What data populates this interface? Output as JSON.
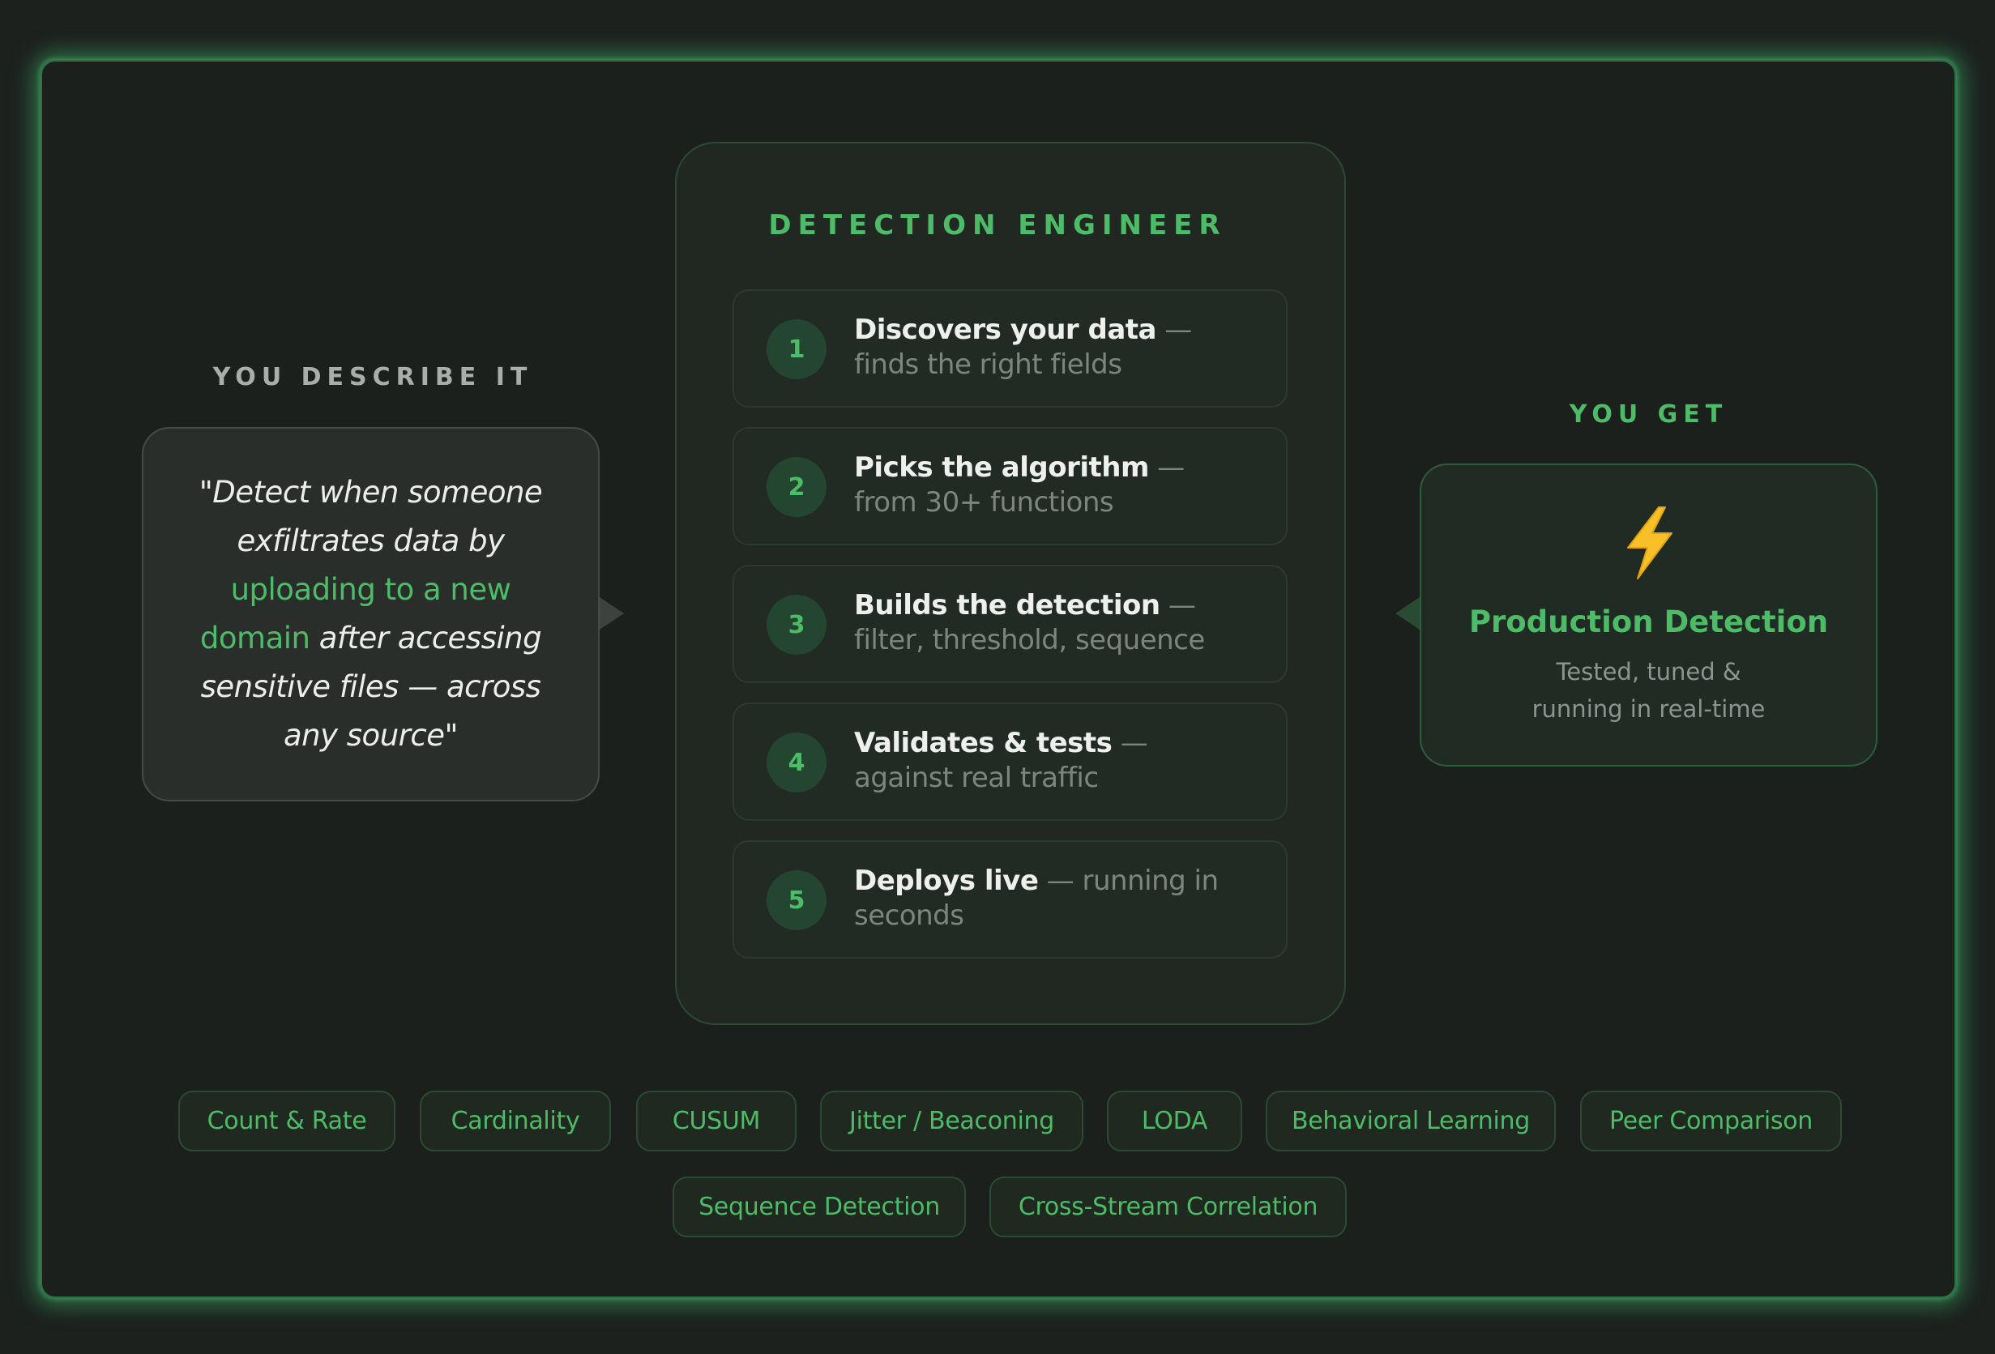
{
  "describe": {
    "label": "YOU DESCRIBE IT",
    "quote_part1": "\"Detect when someone exfiltrates data by ",
    "quote_highlight": "uploading to a new domain",
    "quote_part2": " after accessing sensitive files — across any source\""
  },
  "engineer": {
    "title": "DETECTION ENGINEER",
    "steps": [
      {
        "num": "1",
        "title": "Discovers your data",
        "desc": " — finds the right fields"
      },
      {
        "num": "2",
        "title": "Picks the algorithm",
        "desc": " — from 30+ functions"
      },
      {
        "num": "3",
        "title": "Builds the detection",
        "desc": " — filter, threshold, sequence"
      },
      {
        "num": "4",
        "title": "Validates & tests",
        "desc": " — against real traffic"
      },
      {
        "num": "5",
        "title": "Deploys live",
        "desc": " — running in seconds"
      }
    ]
  },
  "result": {
    "label": "YOU GET",
    "icon": "lightning-bolt-icon",
    "title": "Production Detection",
    "subtitle_line1": "Tested, tuned &",
    "subtitle_line2": "running in real-time"
  },
  "algorithms": [
    "Count & Rate",
    "Cardinality",
    "CUSUM",
    "Jitter / Beaconing",
    "LODA",
    "Behavioral Learning",
    "Peer Comparison",
    "Sequence Detection",
    "Cross-Stream Correlation"
  ],
  "colors": {
    "accent": "#4dbb68",
    "background": "#1b201c",
    "glow": "#3aa862"
  }
}
